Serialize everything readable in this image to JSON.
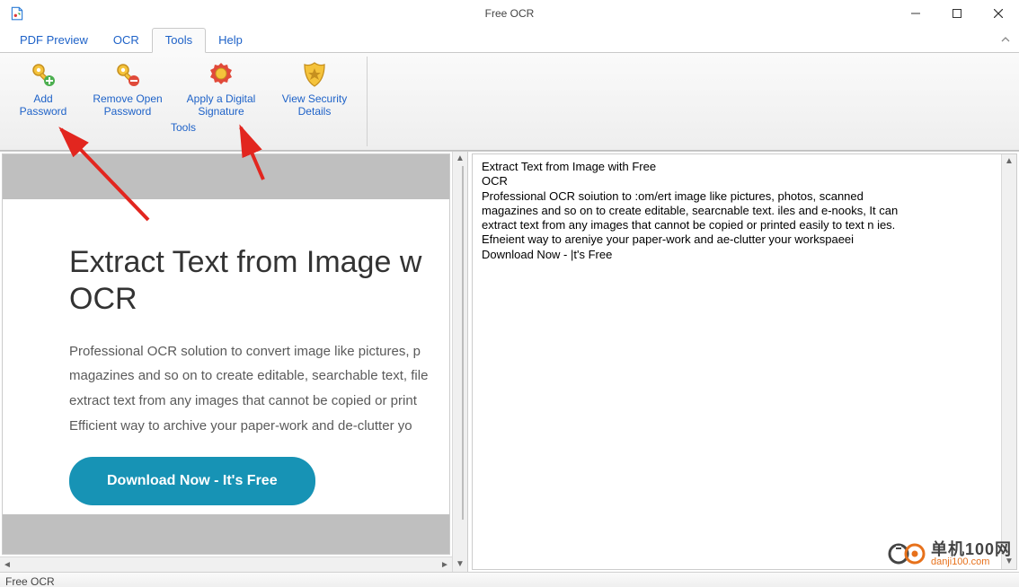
{
  "window": {
    "title": "Free OCR"
  },
  "menu": {
    "tabs": [
      "PDF Preview",
      "OCR",
      "Tools",
      "Help"
    ],
    "active_index": 2
  },
  "ribbon": {
    "group_caption": "Tools",
    "items": [
      {
        "label_l1": "Add",
        "label_l2": "Password",
        "icon": "key-add"
      },
      {
        "label_l1": "Remove Open",
        "label_l2": "Password",
        "icon": "key-remove"
      },
      {
        "label_l1": "Apply a Digital",
        "label_l2": "Signature",
        "icon": "ribbon-cert"
      },
      {
        "label_l1": "View Security",
        "label_l2": "Details",
        "icon": "shield"
      }
    ]
  },
  "preview": {
    "heading": "Extract Text from Image with Free OCR",
    "heading_vis": "Extract Text from Image w\nOCR",
    "paragraph": "Professional OCR solution to convert image like pictures, photos, scanned magazines and so on to create editable, searchable text, files and e-books. It can extract text from any images that cannot be copied or printed easily to text in ies. Efficient way to archive your paper-work and de-clutter your workspace!",
    "paragraph_vis": "Professional OCR solution to convert image like pictures, p\nmagazines and so on to create editable, searchable text, file\nextract text from any images that cannot be copied or print\nEfficient way to archive your paper-work and de-clutter yo",
    "download_btn": "Download Now - It's Free"
  },
  "ocr_output": {
    "text": "Extract Text from Image with Free\nOCR\nProfessional OCR soiution to :om/ert image like pictures, photos, scanned\nmagazines and so on to create editable, searcnable text. iles and e-nooks, It can\nextract text from any images that cannot be copied or printed easily to text n ies.\nEfneient way to areniye your paper-work and ae-clutter your workspaeei\nDownload Now - |t's Free"
  },
  "statusbar": {
    "text": "Free OCR"
  },
  "watermark": {
    "cn": "单机100网",
    "url": "danji100.com"
  }
}
